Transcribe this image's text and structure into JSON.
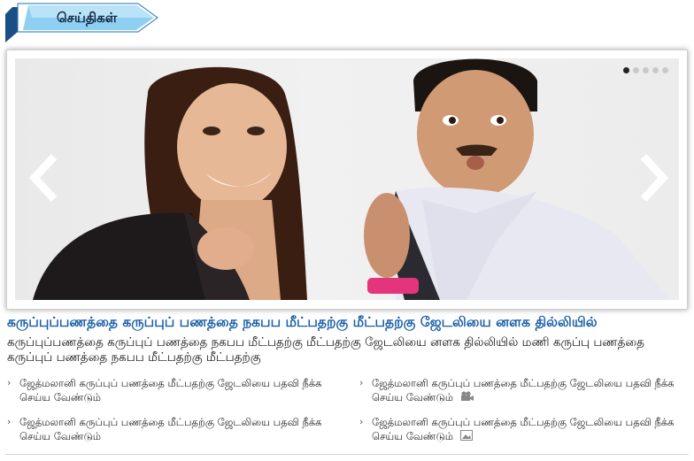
{
  "section": {
    "title": "செய்திகள்"
  },
  "slider": {
    "image_icon": "photo-slide",
    "prev_icon": "chevron-left-icon",
    "next_icon": "chevron-right-icon",
    "dots_total": 5,
    "active_dot": 1
  },
  "headline": "கருப்புப்பணத்தை கருப்புப் பணத்தை நகபப மீட்பதற்கு மீட்பதற்கு ஜேடலியை னளக தில்லியில்",
  "summary": "கருப்புப்பணத்தை கருப்புப் பணத்தை நகபப மீட்பதற்கு மீட்பதற்கு ஜேடலியை னளக தில்லியில் மணி கருப்பு பணத்தை கருப்புப் பணத்தை நகபப மீட்பதற்கு மீட்பதற்கு",
  "links": [
    {
      "text": "ஜேத்மலானி கருப்புப் பணத்தை மீட்பதற்கு ஜேடலியை பதவி நீக்க செய்ய வேண்டும்",
      "media_icon": ""
    },
    {
      "text": "ஜேத்மலானி கருப்புப் பணத்தை மீட்பதற்கு ஜேடலியை பதவி நீக்க செய்ய வேண்டும்",
      "media_icon": "video-camera-icon"
    },
    {
      "text": "ஜேத்மலானி கருப்புப் பணத்தை மீட்பதற்கு ஜேடலியை பதவி நீக்க செய்ய வேண்டும்",
      "media_icon": ""
    },
    {
      "text": "ஜேத்மலானி கருப்புப் பணத்தை மீட்பதற்கு ஜேடலியை பதவி நீக்க செய்ய வேண்டும்",
      "media_icon": "photo-icon"
    }
  ],
  "colors": {
    "accent": "#1a5fa8",
    "tab": "#7fc6ee",
    "tab_dark": "#1e6fb0"
  }
}
